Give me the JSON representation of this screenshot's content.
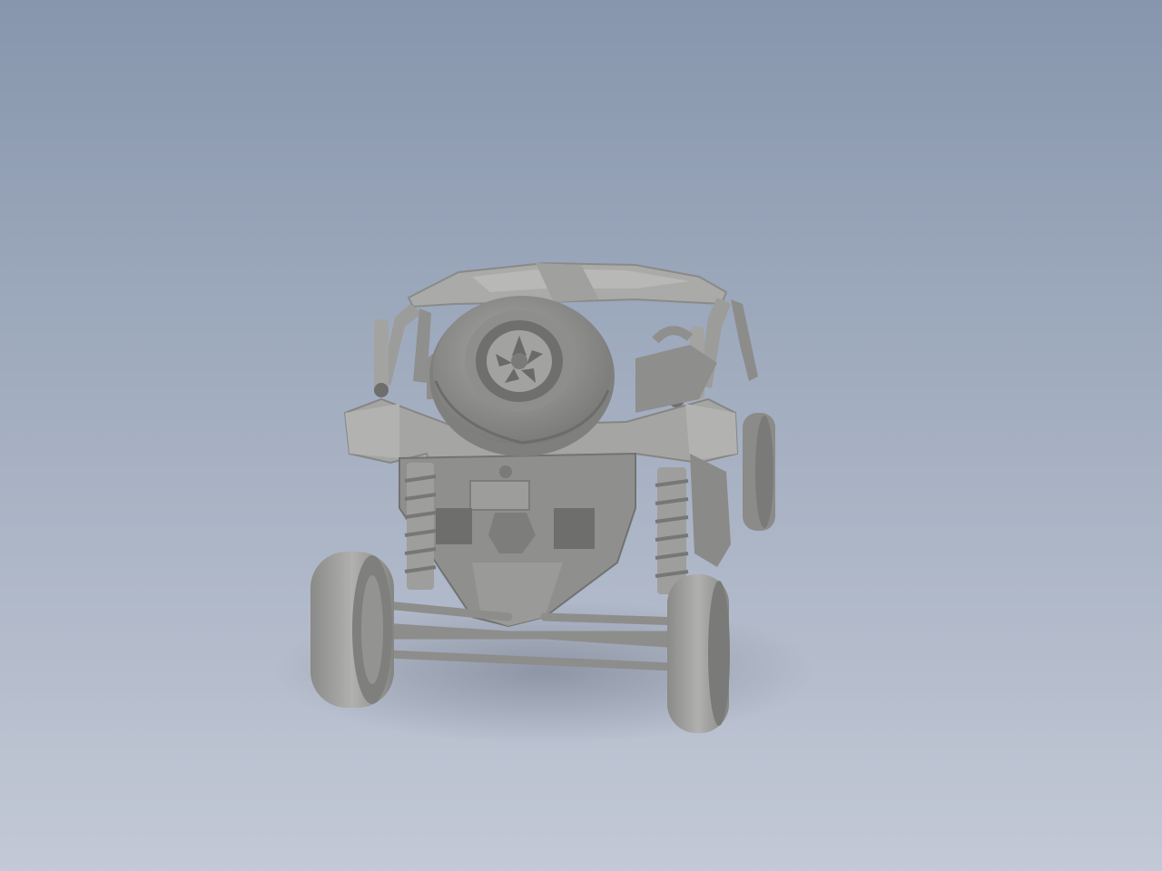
{
  "viewer": {
    "background_top": "#8796ad",
    "background_bottom": "#c3c9d6",
    "model_color": "#9a9a98",
    "model_shadow": "#6c6c6a",
    "model_highlight": "#bdbdbb",
    "ground_shadow": "#7d8596",
    "model_name": "",
    "subject": "utv-rear-view-with-spare-tire"
  }
}
